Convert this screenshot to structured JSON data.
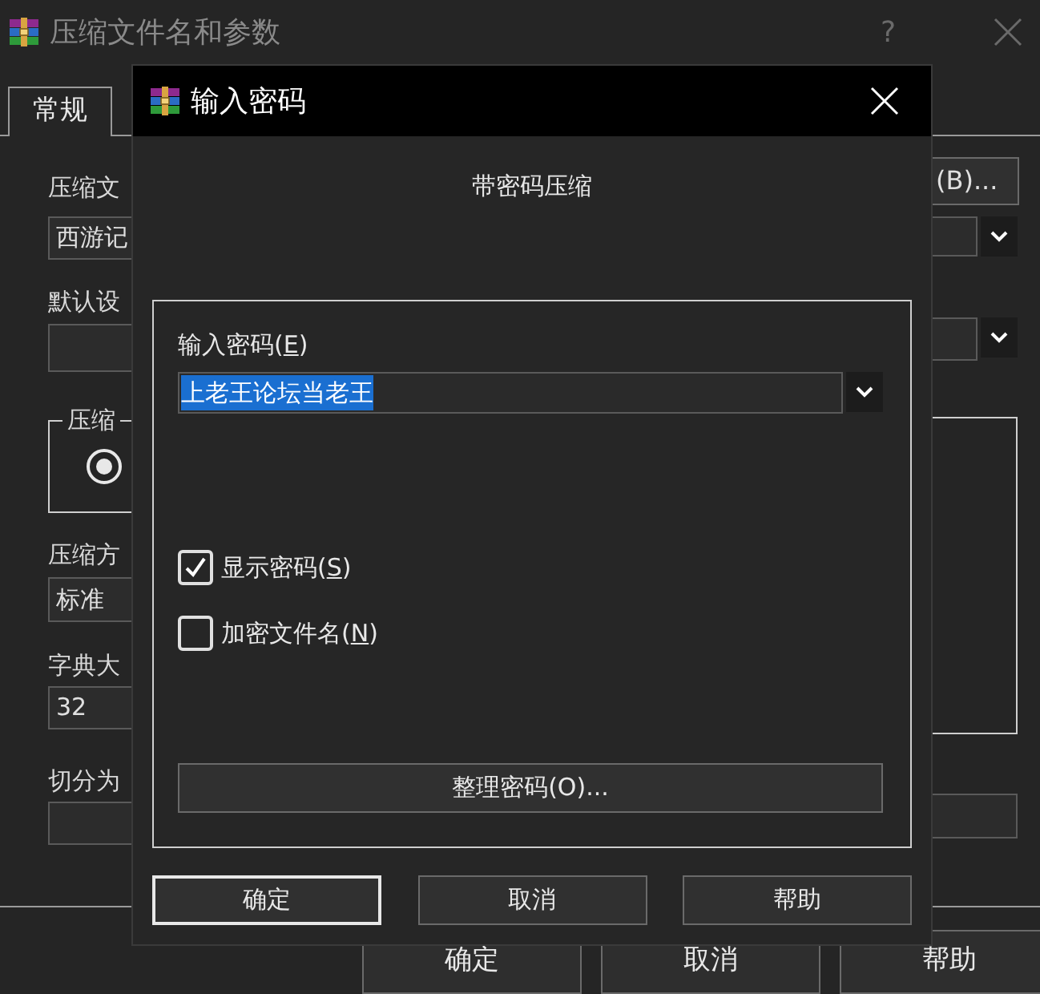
{
  "background_window": {
    "title": "压缩文件名和参数",
    "help": "?",
    "tab": {
      "label": "常规",
      "selected": true
    },
    "left_labels": [
      "压缩文",
      "默认设",
      "压缩方",
      "字典大",
      "切分为"
    ],
    "archive_name_field": {
      "value": "西游记"
    },
    "group": {
      "label": "压缩",
      "radio_selected": true
    },
    "method_field": {
      "value": "标准"
    },
    "dictionary_field": {
      "value": "32"
    },
    "browse_button": "(B)...",
    "buttons": [
      "确定",
      "取消",
      "帮助"
    ]
  },
  "dialog": {
    "title": "输入密码",
    "heading": "带密码压缩",
    "password": {
      "label": {
        "text": "输入密码(",
        "key": "E",
        "end": ")"
      },
      "value": "上老王论坛当老王",
      "highlighted": true
    },
    "options": [
      {
        "label": {
          "text": "显示密码(",
          "key": "S",
          "end": ")"
        },
        "checked": true
      },
      {
        "label": {
          "text": "加密文件名(",
          "key": "N",
          "end": ")"
        },
        "checked": false
      }
    ],
    "organize_button": "整理密码(O)...",
    "buttons": [
      {
        "label": "确定",
        "default": true
      },
      {
        "label": "取消",
        "default": false
      },
      {
        "label": "帮助",
        "default": false
      }
    ]
  }
}
